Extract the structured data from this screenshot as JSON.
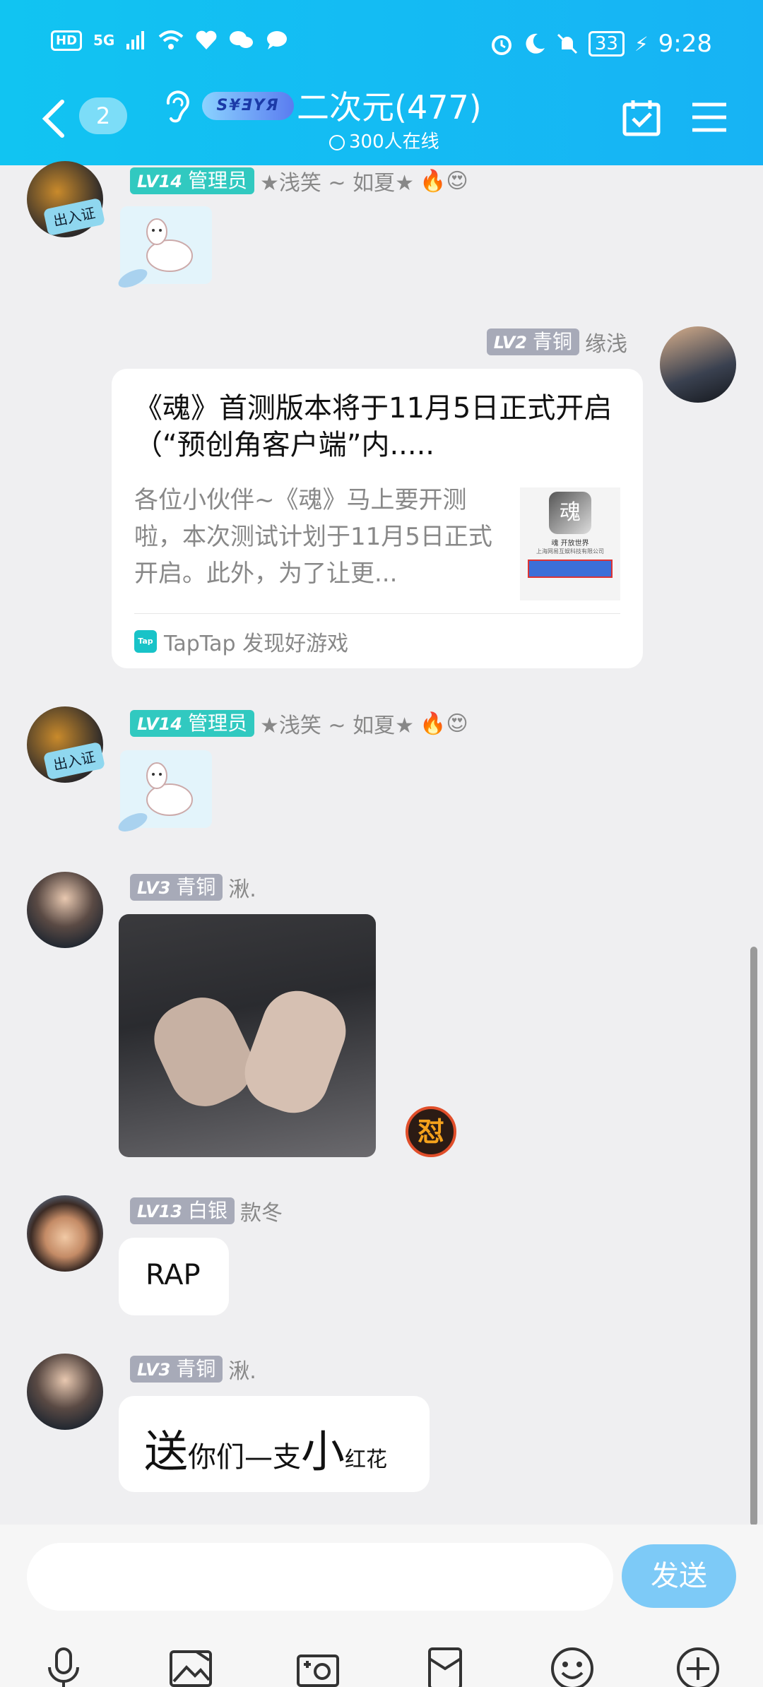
{
  "status_bar": {
    "hd": "HD",
    "network": "5G",
    "battery": "33",
    "time": "9:28"
  },
  "header": {
    "unread_count": "2",
    "group_logo_text": "S¥ƎYЯ",
    "title": "二次元(477)",
    "online": "300人在线"
  },
  "messages": [
    {
      "level": "LV14",
      "role": "管理员",
      "name": "★浅笑 ~ 如夏★",
      "emojis": "🔥😍",
      "sticker": "alpaca"
    },
    {
      "level": "LV2",
      "role": "青铜",
      "name": "缘浅",
      "card": {
        "title": "《魂》首测版本将于11月5日正式开启（“预创角客户端”内.....",
        "desc": "各位小伙伴~《魂》马上要开测啦，本次测试计划于11月5日正式开启。此外，为了让更...",
        "thumb_text": "魂 开放世界",
        "thumb_sub": "上海网易互娱科技有限公司",
        "source_icon": "Tap",
        "source": "TapTap 发现好游戏"
      }
    },
    {
      "level": "LV14",
      "role": "管理员",
      "name": "★浅笑 ~ 如夏★",
      "emojis": "🔥😍",
      "sticker": "alpaca"
    },
    {
      "level": "LV3",
      "role": "青铜",
      "name": "湫.",
      "image": "hands-gif",
      "reaction": "怼"
    },
    {
      "level": "LV13",
      "role": "白银",
      "name": "款冬",
      "text": "RAP"
    },
    {
      "level": "LV3",
      "role": "青铜",
      "name": "湫.",
      "rich_text": [
        "送",
        "你们",
        "—",
        "支",
        "小",
        "红花"
      ]
    }
  ],
  "composer": {
    "placeholder": "",
    "send_label": "发送"
  },
  "toolbar_icons": [
    "microphone-icon",
    "image-icon",
    "camera-icon",
    "red-packet-icon",
    "emoji-icon",
    "plus-icon"
  ]
}
